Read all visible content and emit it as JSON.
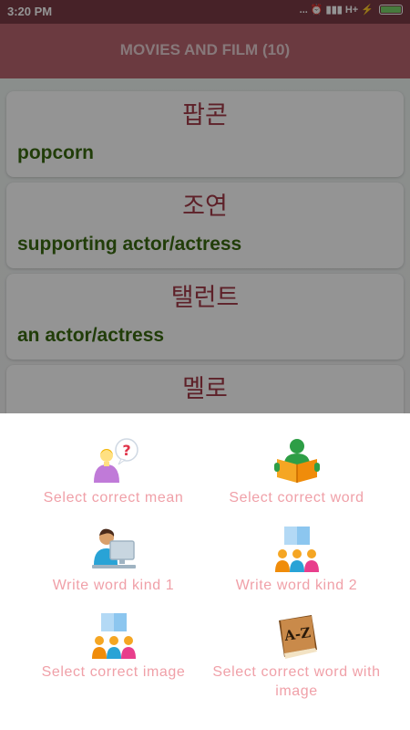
{
  "status_bar": {
    "time": "3:20 PM",
    "indicators": "... ⏰ ▮▮▮ H+ ⚡"
  },
  "app_bar": {
    "title": "MOVIES AND FILM (10)"
  },
  "words": [
    {
      "korean": "팝콘",
      "english": "popcorn"
    },
    {
      "korean": "조연",
      "english": "supporting actor/actress"
    },
    {
      "korean": "탤런트",
      "english": "an actor/actress"
    },
    {
      "korean": "멜로",
      "english": ""
    }
  ],
  "menu": {
    "options": [
      {
        "label": "Select correct mean",
        "icon": "question-person-icon"
      },
      {
        "label": "Select correct word",
        "icon": "reading-book-icon"
      },
      {
        "label": "Write word kind 1",
        "icon": "computer-user-icon"
      },
      {
        "label": "Write word kind 2",
        "icon": "group-card-icon"
      },
      {
        "label": "Select correct image",
        "icon": "group-card-icon"
      },
      {
        "label": "Select correct word with image",
        "icon": "dictionary-az-icon"
      }
    ]
  },
  "colors": {
    "app_bar": "#b8646f",
    "status_bar": "#7a3c45",
    "korean_text": "#a33a48",
    "english_text": "#3a6a10",
    "menu_label": "#f0a0a8"
  }
}
